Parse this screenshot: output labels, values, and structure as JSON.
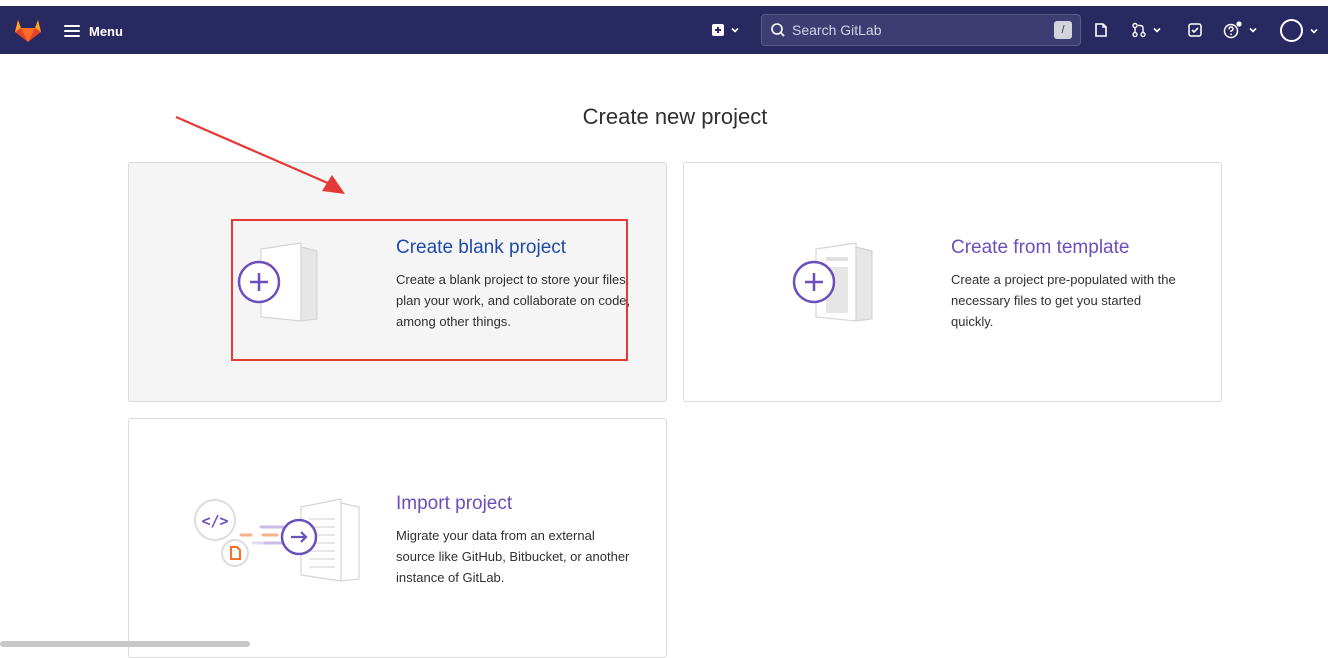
{
  "navbar": {
    "menu_label": "Menu",
    "search_placeholder": "Search GitLab",
    "search_shortcut": "/"
  },
  "page": {
    "title": "Create new project"
  },
  "cards": {
    "blank": {
      "title": "Create blank project",
      "description": "Create a blank project to store your files, plan your work, and collaborate on code, among other things."
    },
    "template": {
      "title": "Create from template",
      "description": "Create a project pre-populated with the necessary files to get you started quickly."
    },
    "import": {
      "title": "Import project",
      "description": "Migrate your data from an external source like GitHub, Bitbucket, or another instance of GitLab."
    }
  },
  "colors": {
    "navbar": "#292961",
    "accent_purple": "#6b4fbb",
    "active_title": "#1f4aa8",
    "highlight_red": "#e53935"
  },
  "icons": [
    "gitlab-logo",
    "hamburger-icon",
    "plus-square-icon",
    "search-icon",
    "issues-icon",
    "merge-request-icon",
    "todo-icon",
    "help-icon",
    "avatar"
  ]
}
